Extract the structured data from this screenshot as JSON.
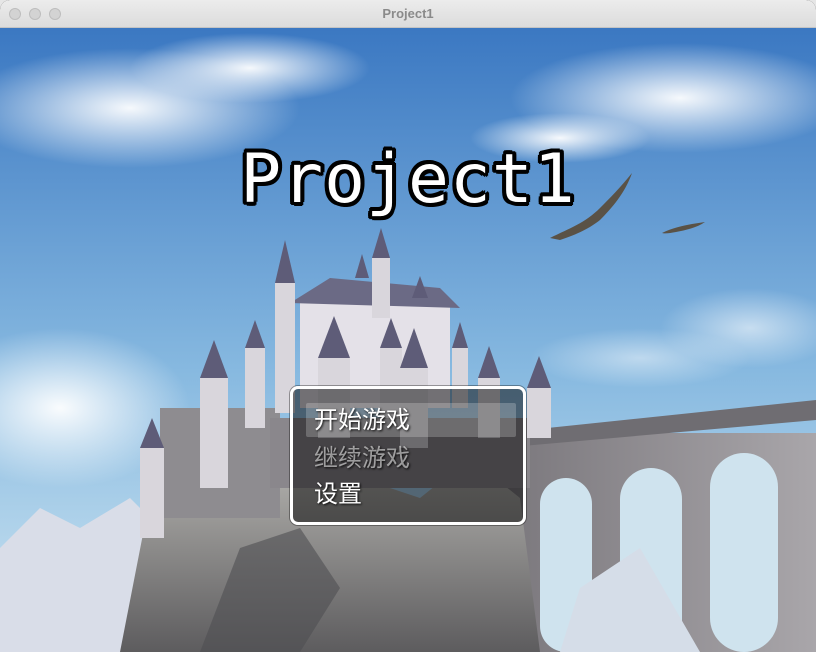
{
  "window": {
    "title": "Project1"
  },
  "game": {
    "title": "Project1"
  },
  "menu": {
    "items": [
      {
        "label": "开始游戏",
        "state": "selected"
      },
      {
        "label": "继续游戏",
        "state": "disabled"
      },
      {
        "label": "设置",
        "state": "normal"
      }
    ]
  },
  "colors": {
    "sky_top": "#3f7fc4",
    "sky_bottom": "#bfe0f2",
    "stone": "#8b8a8e",
    "roof": "#5b5a7a"
  }
}
